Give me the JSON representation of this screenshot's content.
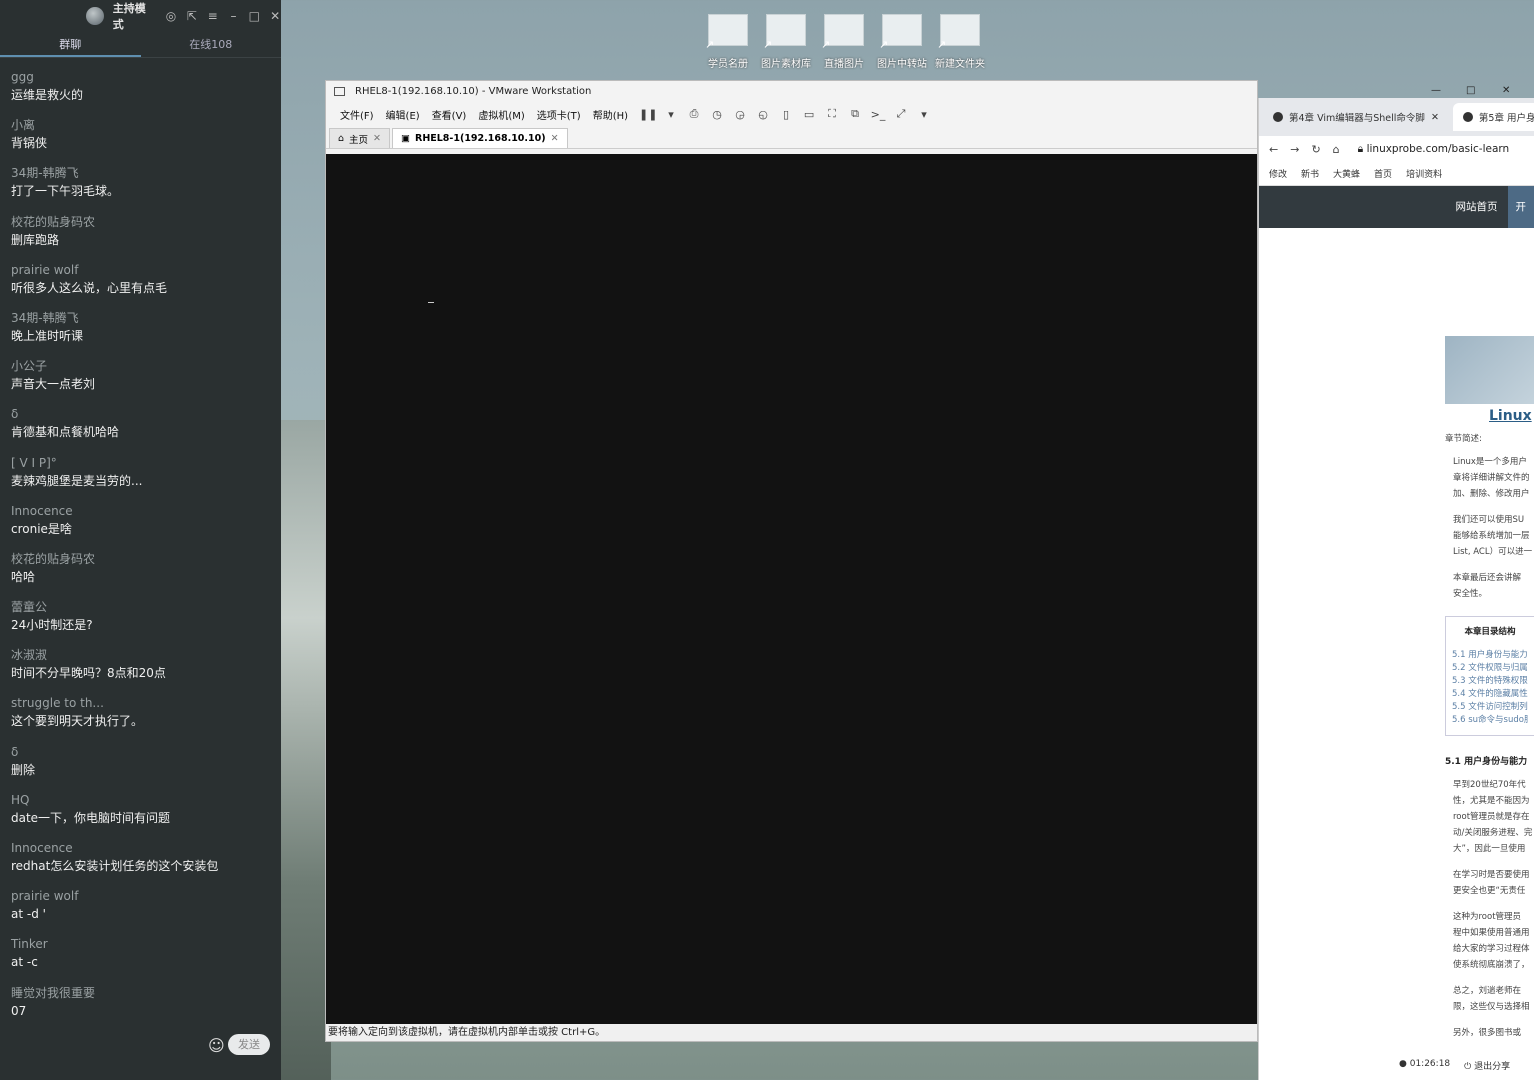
{
  "chat": {
    "mode_label": "主持模式",
    "tabs": [
      "群聊",
      "在线108"
    ],
    "messages": [
      {
        "sender": "ggg",
        "text": "运维是救火的"
      },
      {
        "sender": "小离",
        "text": "背锅侠"
      },
      {
        "sender": "34期-韩腾飞",
        "text": "打了一下午羽毛球。"
      },
      {
        "sender": "校花的贴身码农",
        "text": "删库跑路"
      },
      {
        "sender": "prairie wolf",
        "text": "听很多人这么说，心里有点毛"
      },
      {
        "sender": "34期-韩腾飞",
        "text": "晚上准时听课"
      },
      {
        "sender": "小公子",
        "text": "声音大一点老刘"
      },
      {
        "sender": "δ",
        "text": "肯德基和点餐机哈哈"
      },
      {
        "sender": "[ V I P]°",
        "text": "麦辣鸡腿堡是麦当劳的..."
      },
      {
        "sender": "Innocence",
        "text": "cronie是啥"
      },
      {
        "sender": "校花的贴身码农",
        "text": "哈哈"
      },
      {
        "sender": "蕾童公",
        "text": "24小时制还是?"
      },
      {
        "sender": "冰淑淑",
        "text": "时间不分早晚吗？8点和20点"
      },
      {
        "sender": "struggle to th...",
        "text": "这个要到明天才执行了。"
      },
      {
        "sender": "δ",
        "text": "删除"
      },
      {
        "sender": "HQ",
        "text": "date一下，你电脑时间有问题"
      },
      {
        "sender": "Innocence",
        "text": "redhat怎么安装计划任务的这个安装包"
      },
      {
        "sender": "prairie wolf",
        "text": "at -d '"
      },
      {
        "sender": "Tinker",
        "text": "at -c"
      },
      {
        "sender": "睡觉对我很重要",
        "text": "07"
      }
    ],
    "send_label": "发送"
  },
  "desktop": {
    "icons": [
      "学员名册",
      "图片素材库",
      "直播图片",
      "图片中转站",
      "新建文件夹"
    ]
  },
  "vmware": {
    "title": "RHEL8-1(192.168.10.10) - VMware Workstation",
    "menus": [
      "文件(F)",
      "编辑(E)",
      "查看(V)",
      "虚拟机(M)",
      "选项卡(T)",
      "帮助(H)"
    ],
    "tabs": {
      "home": "主页",
      "vm": "RHEL8-1(192.168.10.10)"
    },
    "status": "要将输入定向到该虚拟机，请在虚拟机内部单击或按 Ctrl+G。"
  },
  "browser": {
    "tabs": [
      "第4章 Vim编辑器与Shell命令脚",
      "第5章 用户身"
    ],
    "url": "linuxprobe.com/basic-learn",
    "bookmarks": [
      "修改",
      "新书",
      "大黄蜂",
      "首页",
      "培训资料"
    ],
    "site_nav": [
      "网站首页",
      "开"
    ],
    "article": {
      "title": "Linux",
      "summary_label": "章节简述:",
      "paragraphs": [
        "Linux是一个多用户",
        "章将详细讲解文件的",
        "加、删除、修改用户",
        "我们还可以使用SU",
        "能够给系统增加一层",
        "List, ACL）可以进一",
        "本章最后还会讲解",
        "安全性。"
      ],
      "toc_title": "本章目录结构",
      "toc_items": [
        "5.1 用户身份与能力",
        "5.2 文件权限与归属",
        "5.3 文件的特殊权限",
        "5.4 文件的隐藏属性",
        "5.5 文件访问控制列",
        "5.6 su命令与sudo服"
      ],
      "section": "5.1 用户身份与能力",
      "body": [
        "早到20世纪70年代",
        "性，尤其是不能因为",
        "root管理员就是存在",
        "动/关闭服务进程、完",
        "大”，因此一旦使用",
        "在学习时是否要使用",
        "更安全也更“无责任",
        "这种为root管理员",
        "程中如果使用普通用",
        "给大家的学习过程体",
        "使系统彻底崩溃了，",
        "总之，刘遄老师在",
        "限，这些仅与选择相",
        "另外，很多图书或"
      ]
    },
    "timer": "01:26:18",
    "exit_share": "退出分享"
  }
}
